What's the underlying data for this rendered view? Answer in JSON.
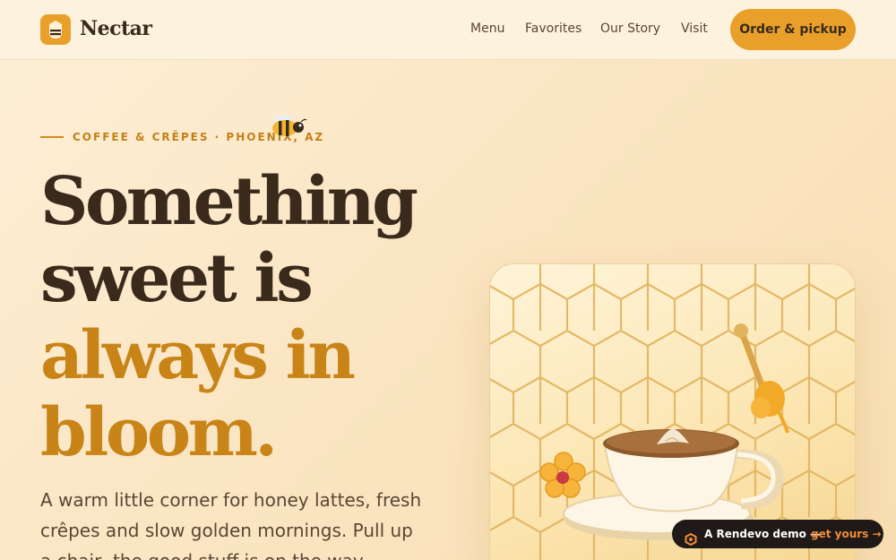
{
  "nav": {
    "brand": "Nectar",
    "links": [
      "Menu",
      "Favorites",
      "Our Story",
      "Visit"
    ],
    "cta": "Order & pickup"
  },
  "hero": {
    "kicker": "COFFEE & CRÊPES · PHOENIX, AZ",
    "headline_dark_1": "Something",
    "headline_dark_2": "sweet is",
    "headline_gold_1": "always in",
    "headline_gold_2": "bloom.",
    "lead": "A warm little corner for honey lattes, fresh crêpes and slow golden mornings. Pull up a chair, the good stuff is on the way."
  },
  "badge": {
    "text": "A Rendevo demo —",
    "link": "get yours →"
  },
  "colors": {
    "accent": "#e8a02a",
    "gold_text": "#c98418",
    "dark_text": "#3a2a1c"
  }
}
